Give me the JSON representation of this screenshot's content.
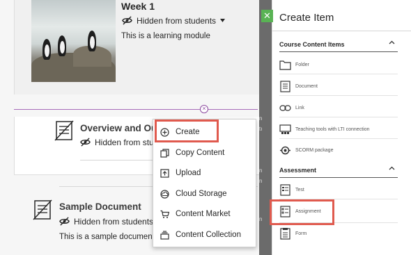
{
  "module": {
    "title": "Week 1",
    "visibility": "Hidden from students",
    "description": "This is a learning module"
  },
  "items": [
    {
      "title": "Overview and Ou",
      "visibility": "Hidden from stu"
    },
    {
      "title": "Sample Document",
      "visibility": "Hidden from students",
      "description": "This is a sample documen"
    }
  ],
  "context_menu": {
    "items": [
      {
        "label": "Create",
        "icon": "plus-circle-icon"
      },
      {
        "label": "Copy Content",
        "icon": "copy-icon"
      },
      {
        "label": "Upload",
        "icon": "upload-icon"
      },
      {
        "label": "Cloud Storage",
        "icon": "cloud-icon"
      },
      {
        "label": "Content Market",
        "icon": "cart-icon"
      },
      {
        "label": "Content Collection",
        "icon": "collection-icon"
      }
    ]
  },
  "panel": {
    "title": "Create Item",
    "close_label": "✕",
    "sections": [
      {
        "heading": "Course Content Items",
        "items": [
          {
            "label": "Folder",
            "icon": "folder-icon"
          },
          {
            "label": "Document",
            "icon": "document-icon"
          },
          {
            "label": "Link",
            "icon": "link-icon"
          },
          {
            "label": "Teaching tools with LTI connection",
            "icon": "lti-icon"
          },
          {
            "label": "SCORM package",
            "icon": "scorm-icon"
          }
        ]
      },
      {
        "heading": "Assessment",
        "items": [
          {
            "label": "Test",
            "icon": "test-icon"
          },
          {
            "label": "Assignment",
            "icon": "assignment-icon"
          },
          {
            "label": "Form",
            "icon": "form-icon"
          }
        ]
      }
    ]
  },
  "colors": {
    "highlight": "#e05a4e",
    "accent_purple": "#8c4a9e",
    "close_green": "#59b354"
  }
}
